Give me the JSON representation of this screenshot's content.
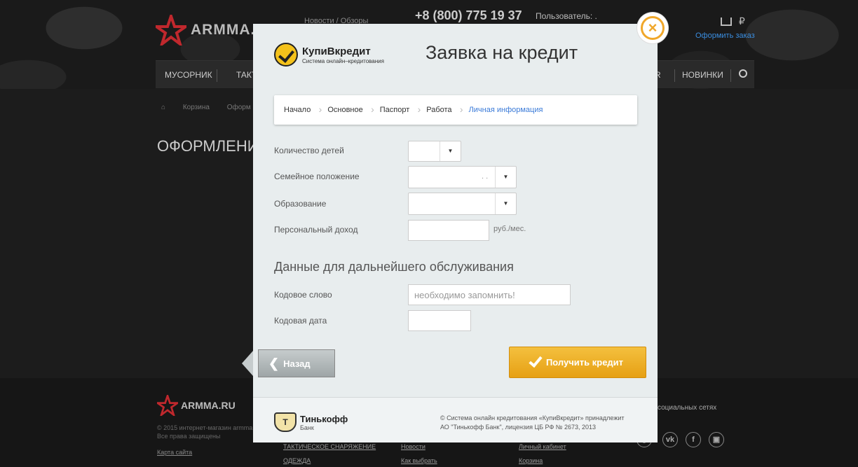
{
  "site": {
    "logo_text": "ARMMA.",
    "news": "Новости / Обзоры",
    "phone": "+8 (800) 775 19 37",
    "user_label": "Пользователь: .",
    "cart_currency": "₽",
    "order_link": "Оформить заказ",
    "nav": [
      "МУСОРНИК",
      "ТАКТ СНАР",
      "R",
      "НОВИНКИ"
    ],
    "breadcrumbs": [
      "Корзина",
      "Оформ"
    ],
    "page_title": "ОФОРМЛЕНИ",
    "footer": {
      "logo_text": "ARMMA.RU",
      "copyright": "© 2015 интернет-магазин armma",
      "rights": "Все права защищены",
      "sitemap": "Карта сайта",
      "col1": [
        "ТАКТИЧЕСКОЕ СНАРЯЖЕНИЕ",
        "ОДЕЖДА"
      ],
      "col2": [
        "Новости",
        "Как выбрать"
      ],
      "col3": [
        "Личный кабинет",
        "Корзина"
      ],
      "social_title": "социальных сетях",
      "social_icons": [
        "instagram-icon",
        "vk-icon",
        "facebook-icon",
        "instagram-square-icon"
      ],
      "social_glyphs": [
        "◎",
        "vk",
        "f",
        "▣"
      ]
    }
  },
  "modal": {
    "brand_name": "КупиВкредит",
    "brand_sub": "Система онлайн–кредитования",
    "title": "Заявка на кредит",
    "close_glyph": "×",
    "steps": [
      {
        "label": "Начало",
        "current": false
      },
      {
        "label": "Основное",
        "current": false
      },
      {
        "label": "Паспорт",
        "current": false
      },
      {
        "label": "Работа",
        "current": false
      },
      {
        "label": "Личная информация",
        "current": true
      }
    ],
    "fields": {
      "children_label": "Количество детей",
      "children_value": "",
      "marital_label": "Семейное положение",
      "marital_value": ". .",
      "education_label": "Образование",
      "education_value": "",
      "income_label": "Персональный доход",
      "income_value": "",
      "income_unit": "руб./мес."
    },
    "section_title": "Данные для дальнейшего обслуживания",
    "code_word_label": "Кодовое слово",
    "code_word_placeholder": "необходимо запомнить!",
    "code_date_label": "Кодовая дата",
    "back_label": "Назад",
    "submit_label": "Получить кредит",
    "footer": {
      "bank_name": "Тинькофф",
      "bank_sub": "Банк",
      "legal_line1": "© Система онлайн кредитования «КупиВкредит» принадлежит",
      "legal_line2": "АО \"Тинькофф Банк\", лицензия ЦБ РФ № 2673, 2013"
    }
  },
  "colors": {
    "accent": "#f0a72a",
    "current_step": "#3b7bd8",
    "order_link": "#3b8ee0"
  }
}
